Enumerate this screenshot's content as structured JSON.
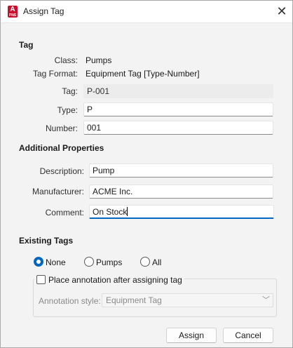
{
  "window": {
    "title": "Assign Tag",
    "app_icon_letter": "A",
    "app_icon_sub": "PNS"
  },
  "tag": {
    "section_title": "Tag",
    "class_label": "Class:",
    "class_value": "Pumps",
    "format_label": "Tag Format:",
    "format_value": "Equipment Tag [Type-Number]",
    "tag_label": "Tag:",
    "tag_value": "P-001",
    "type_label": "Type:",
    "type_value": "P",
    "number_label": "Number:",
    "number_value": "001"
  },
  "additional": {
    "section_title": "Additional Properties",
    "description_label": "Description:",
    "description_value": "Pump",
    "manufacturer_label": "Manufacturer:",
    "manufacturer_value": "ACME Inc.",
    "comment_label": "Comment:",
    "comment_value": "On Stock"
  },
  "existing": {
    "section_title": "Existing Tags",
    "options": [
      "None",
      "Pumps",
      "All"
    ],
    "selected": "None",
    "place_annotation_label": "Place annotation after assigning tag",
    "place_annotation_checked": false,
    "annotation_style_label": "Annotation style:",
    "annotation_style_value": "Equipment Tag"
  },
  "buttons": {
    "assign": "Assign",
    "cancel": "Cancel"
  }
}
